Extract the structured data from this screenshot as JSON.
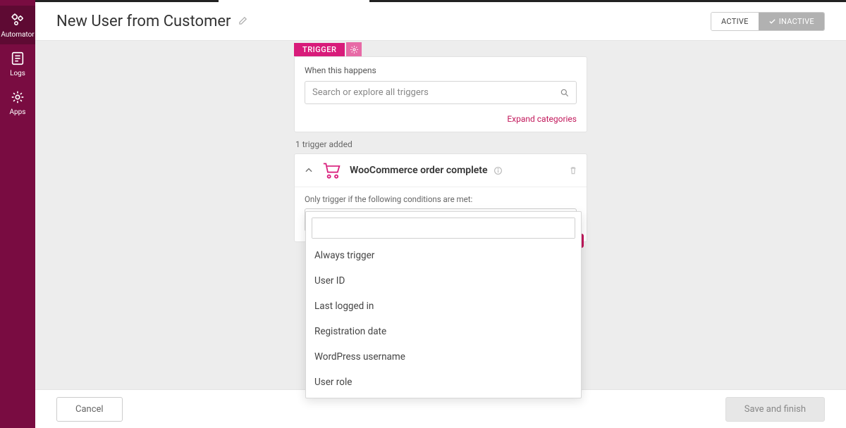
{
  "sidebar": {
    "items": [
      {
        "label": "Automator",
        "name": "sidebar-automator"
      },
      {
        "label": "Logs",
        "name": "sidebar-logs"
      },
      {
        "label": "Apps",
        "name": "sidebar-apps"
      }
    ]
  },
  "header": {
    "title": "New User from Customer",
    "status_active": "ACTIVE",
    "status_inactive": "INACTIVE"
  },
  "trigger": {
    "tab_label": "TRIGGER",
    "when_label": "When this happens",
    "search_placeholder": "Search or explore all triggers",
    "expand_label": "Expand categories",
    "count_label": "1 trigger added",
    "item": {
      "name": "WooCommerce order complete"
    },
    "conditions_label": "Only trigger if the following conditions are met:",
    "select_value": "Always trigger"
  },
  "dropdown": {
    "options": [
      "Always trigger",
      "User ID",
      "Last logged in",
      "Registration date",
      "WordPress username",
      "User role"
    ]
  },
  "footer": {
    "cancel": "Cancel",
    "save": "Save and finish"
  }
}
